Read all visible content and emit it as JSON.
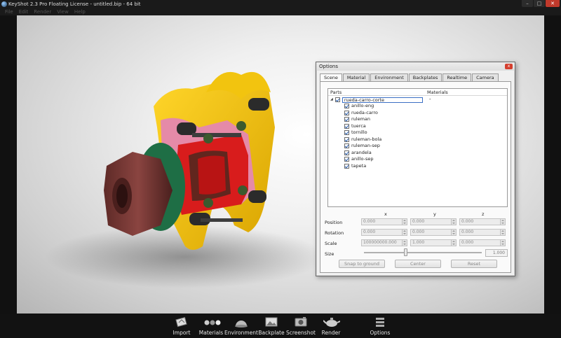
{
  "window": {
    "title": "KeyShot 2.3 Pro Floating License - untitled.bip - 64 bit",
    "minimize": "–",
    "maximize": "□",
    "close": "✕"
  },
  "menu": [
    "File",
    "Edit",
    "Render",
    "View",
    "Help"
  ],
  "options": {
    "title": "Options",
    "close": "x",
    "tabs": [
      "Scene",
      "Material",
      "Environment",
      "Backplates",
      "Realtime",
      "Camera"
    ],
    "active_tab": "Scene",
    "tree": {
      "header_parts": "Parts",
      "header_materials": "Materials",
      "root": {
        "name": "rueda-carro-corte",
        "material": "-"
      },
      "children": [
        "anillo-eng",
        "rueda-carro",
        "ruleman",
        "tuerca",
        "tornillo",
        "ruleman-bola",
        "ruleman-sep",
        "arandela",
        "anillo-sep",
        "tapeta"
      ]
    },
    "axes": [
      "x",
      "y",
      "z"
    ],
    "position_label": "Position",
    "rotation_label": "Rotation",
    "scale_label": "Scale",
    "size_label": "Size",
    "position": [
      "0.000",
      "0.000",
      "0.000"
    ],
    "rotation": [
      "0.000",
      "0.000",
      "0.000"
    ],
    "scale": [
      "100000000.000",
      "1.000",
      "0.000"
    ],
    "size_value": "1.000",
    "size_slider_fraction": 0.35,
    "buttons": {
      "snap": "Snap to ground",
      "center": "Center",
      "reset": "Reset"
    }
  },
  "toolbar": [
    {
      "label": "Import",
      "icon": "import-icon"
    },
    {
      "label": "Materials",
      "icon": "materials-icon"
    },
    {
      "label": "Environment",
      "icon": "environment-icon"
    },
    {
      "label": "Backplate",
      "icon": "backplate-icon"
    },
    {
      "label": "Screenshot",
      "icon": "screenshot-icon"
    },
    {
      "label": "Render",
      "icon": "render-icon"
    },
    {
      "label": "Options",
      "icon": "options-icon"
    }
  ],
  "colors": {
    "part_yellow": "#f2c40f",
    "part_pink": "#e58aa8",
    "part_red": "#d81c1c",
    "nut_brown": "#7a3a36",
    "washer_green": "#1e6e45",
    "bolt_dark": "#2b2b2b",
    "ball_green": "#3c5a2e"
  }
}
